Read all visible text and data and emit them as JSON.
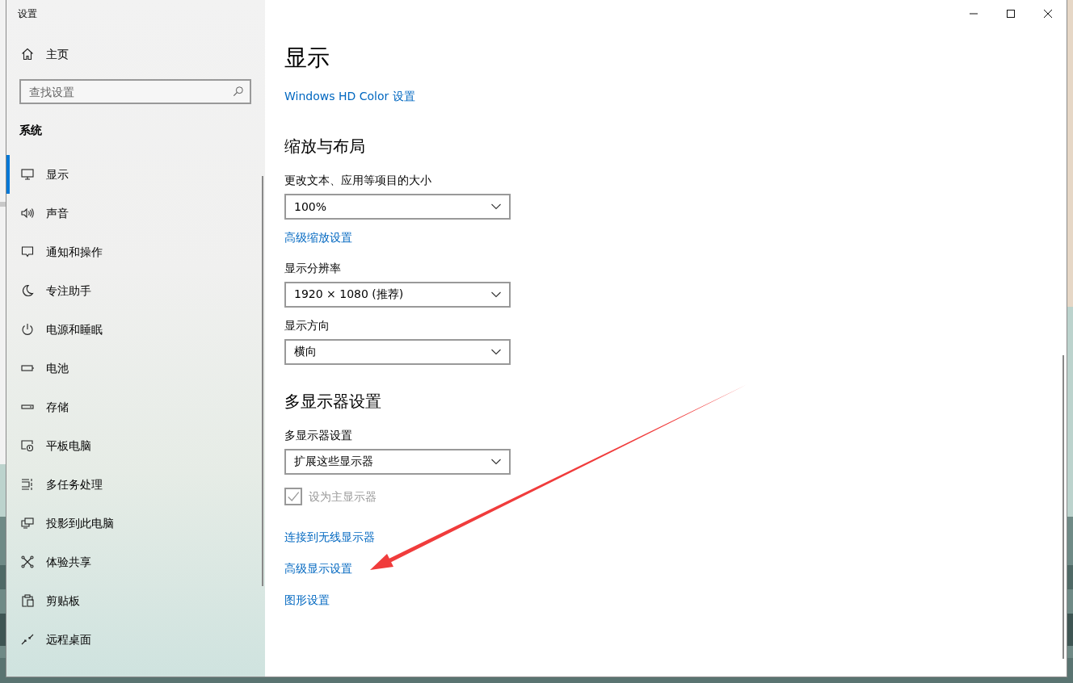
{
  "window": {
    "title": "设置"
  },
  "sidebar": {
    "home": "主页",
    "search": {
      "placeholder": "查找设置"
    },
    "section": "系统",
    "items": [
      {
        "label": "显示",
        "selected": true
      },
      {
        "label": "声音",
        "selected": false
      },
      {
        "label": "通知和操作",
        "selected": false
      },
      {
        "label": "专注助手",
        "selected": false
      },
      {
        "label": "电源和睡眠",
        "selected": false
      },
      {
        "label": "电池",
        "selected": false
      },
      {
        "label": "存储",
        "selected": false
      },
      {
        "label": "平板电脑",
        "selected": false
      },
      {
        "label": "多任务处理",
        "selected": false
      },
      {
        "label": "投影到此电脑",
        "selected": false
      },
      {
        "label": "体验共享",
        "selected": false
      },
      {
        "label": "剪贴板",
        "selected": false
      },
      {
        "label": "远程桌面",
        "selected": false
      }
    ]
  },
  "content": {
    "title": "显示",
    "items": [
      {
        "kind": "link",
        "text": "Windows HD Color 设置"
      },
      {
        "kind": "heading",
        "text": "缩放与布局"
      },
      {
        "kind": "label",
        "text": "更改文本、应用等项目的大小"
      },
      {
        "kind": "dropdown",
        "value": "100%"
      },
      {
        "kind": "link",
        "text": "高级缩放设置"
      },
      {
        "kind": "label",
        "text": "显示分辨率"
      },
      {
        "kind": "dropdown",
        "value": "1920 × 1080 (推荐)"
      },
      {
        "kind": "label",
        "text": "显示方向"
      },
      {
        "kind": "dropdown",
        "value": "横向"
      },
      {
        "kind": "heading",
        "text": "多显示器设置"
      },
      {
        "kind": "label",
        "text": "多显示器设置"
      },
      {
        "kind": "dropdown",
        "value": "扩展这些显示器"
      },
      {
        "kind": "checkbox",
        "label": "设为主显示器",
        "checked": true,
        "disabled": true
      },
      {
        "kind": "link",
        "text": "连接到无线显示器"
      },
      {
        "kind": "link",
        "text": "高级显示设置"
      },
      {
        "kind": "link",
        "text": "图形设置"
      }
    ]
  }
}
